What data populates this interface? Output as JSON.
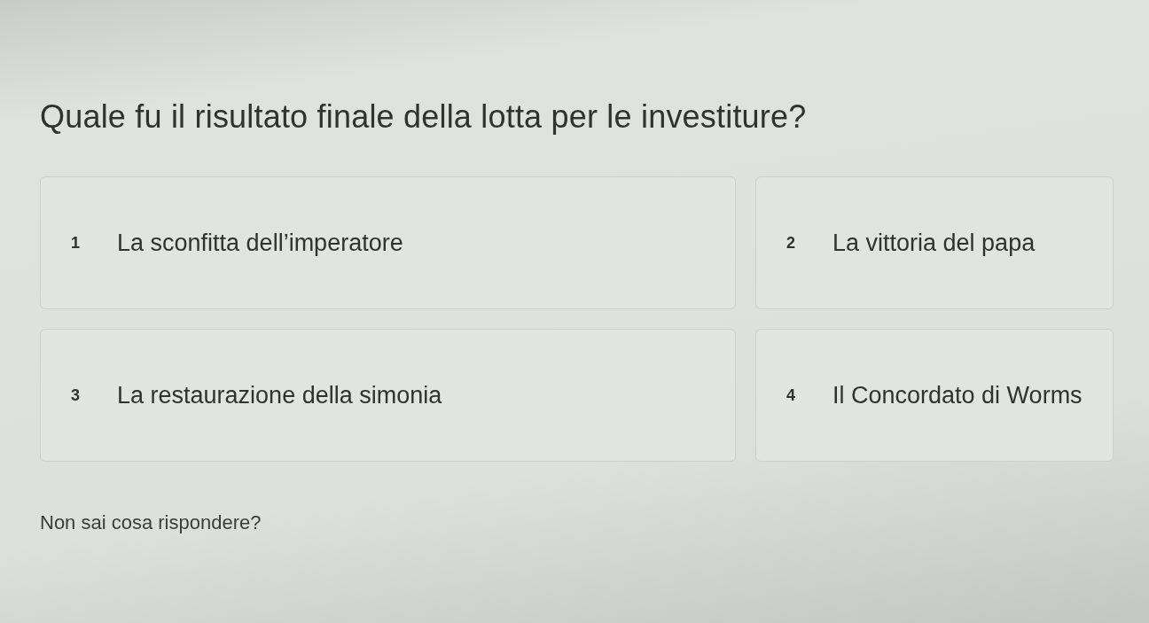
{
  "question": "Quale fu il risultato finale della lotta per le investiture?",
  "answers": [
    {
      "number": "1",
      "text": "La sconfitta dell’imperatore"
    },
    {
      "number": "2",
      "text": "La vittoria del papa"
    },
    {
      "number": "3",
      "text": "La restaurazione della simonia"
    },
    {
      "number": "4",
      "text": "Il Concordato di Worms"
    }
  ],
  "help_link": "Non sai cosa rispondere?"
}
